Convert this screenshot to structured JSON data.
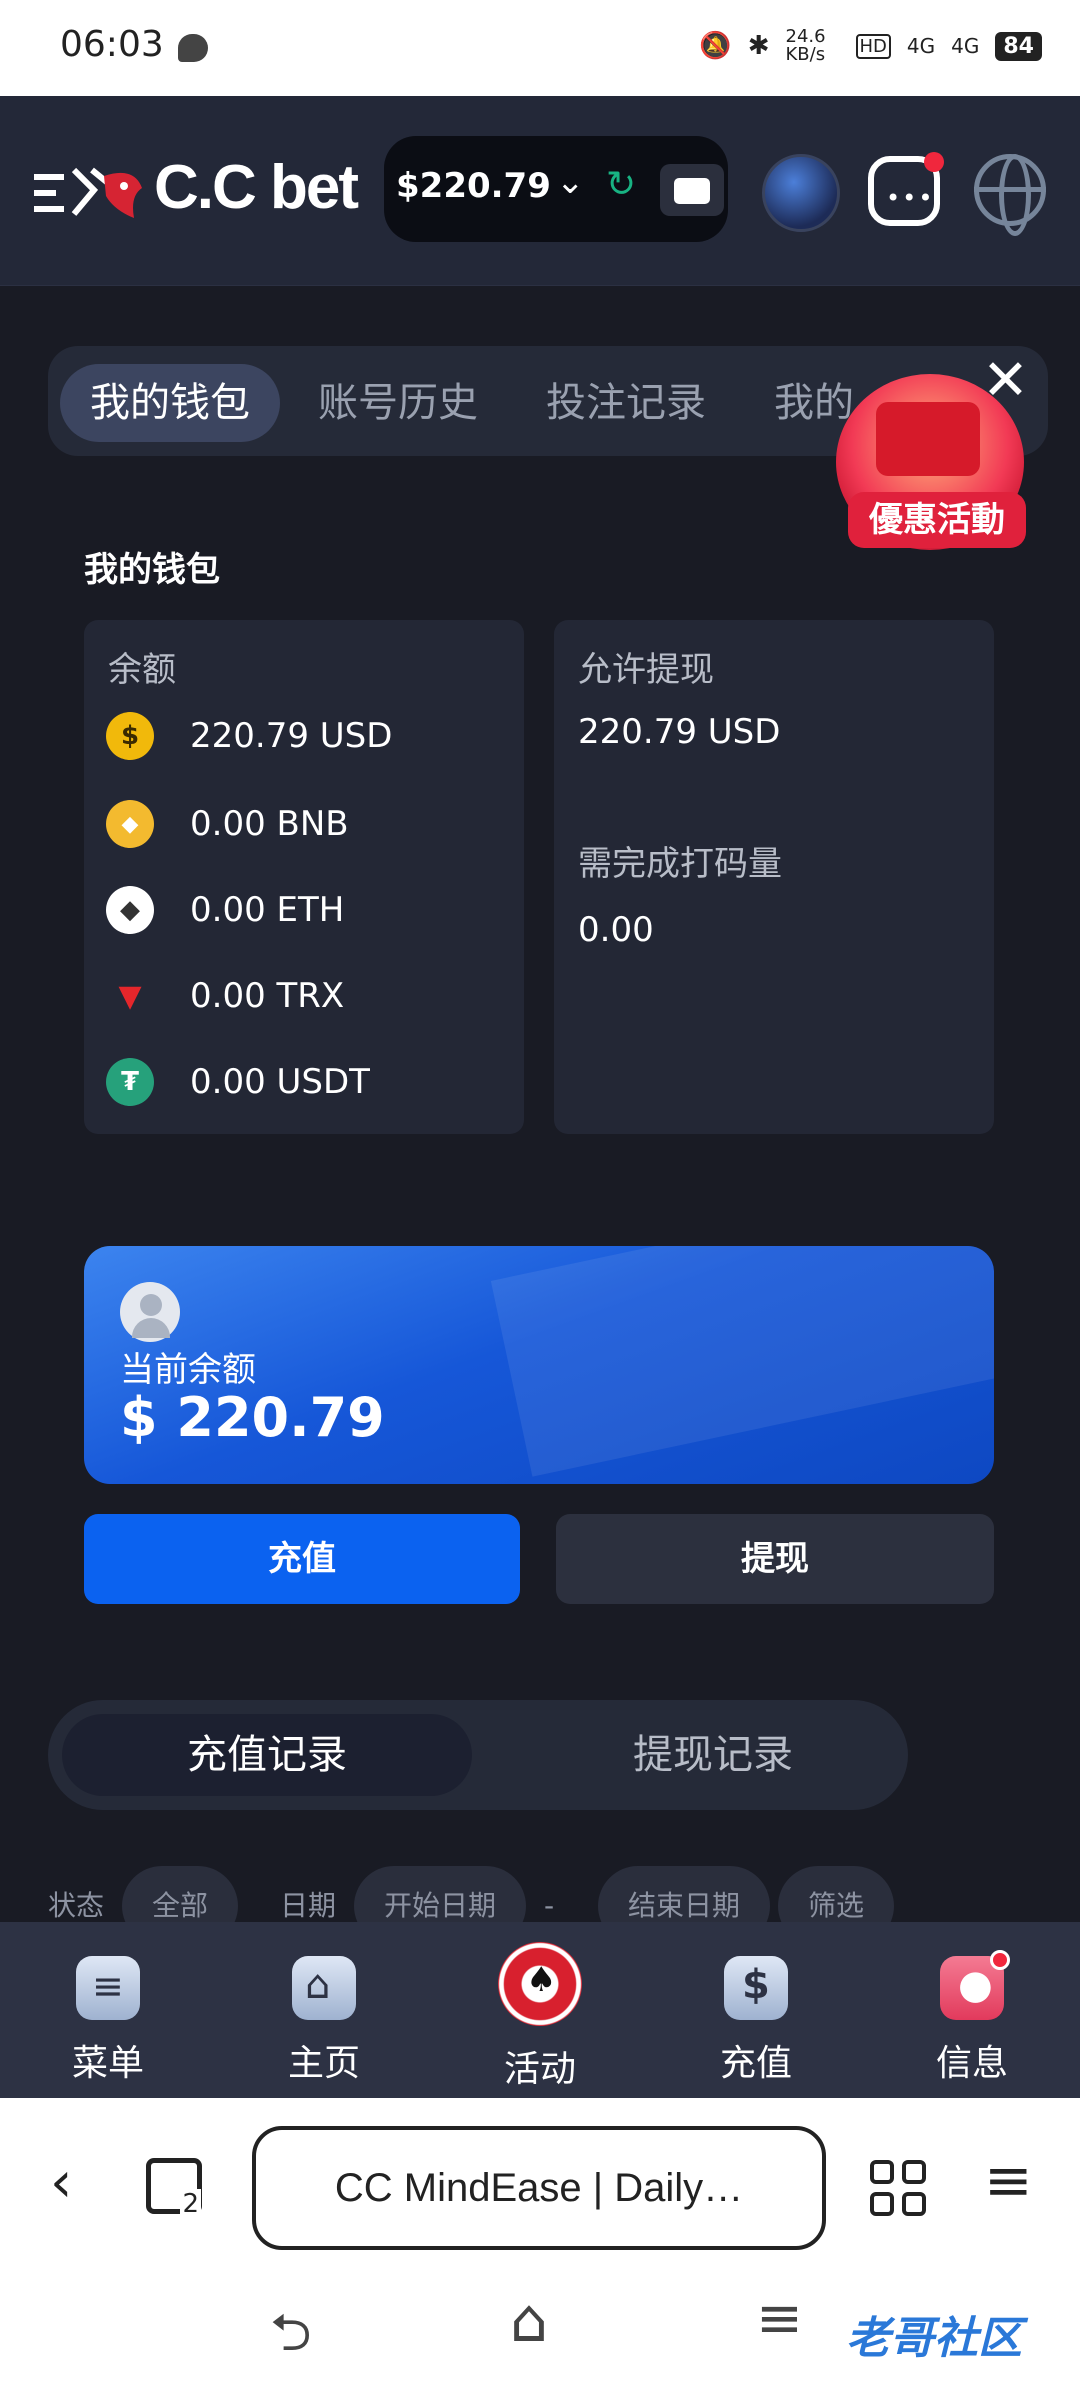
{
  "status": {
    "time": "06:03",
    "net_speed": "24.6 KB/s",
    "signal1": "4G",
    "signal2": "4G",
    "battery": "84",
    "hd": "HD"
  },
  "header": {
    "logo": "C.C bet",
    "balance": "$220.79"
  },
  "tabs": [
    "我的钱包",
    "账号历史",
    "投注记录",
    "我的"
  ],
  "promo": {
    "label": "優惠活動",
    "close": "✕"
  },
  "wallet": {
    "title": "我的钱包",
    "balance_label": "余额",
    "coins": [
      {
        "name": "USD",
        "text": "220.79 USD",
        "color": "#f1b90b",
        "symbol": "$"
      },
      {
        "name": "BNB",
        "text": "0.00 BNB",
        "color": "#f3ba2f",
        "symbol": "◆"
      },
      {
        "name": "ETH",
        "text": "0.00 ETH",
        "color": "#ffffff",
        "symbol": "◆"
      },
      {
        "name": "TRX",
        "text": "0.00 TRX",
        "color": "#e5262b",
        "symbol": "▼"
      },
      {
        "name": "USDT",
        "text": "0.00 USDT",
        "color": "#26a17b",
        "symbol": "₮"
      }
    ],
    "withdrawable_label": "允许提现",
    "withdrawable_value": "220.79 USD",
    "wager_label": "需完成打码量",
    "wager_value": "0.00"
  },
  "current": {
    "label": "当前余额",
    "amount": "$ 220.79"
  },
  "buttons": {
    "deposit": "充值",
    "withdraw": "提现"
  },
  "records": {
    "deposit": "充值记录",
    "withdraw": "提现记录"
  },
  "filter": {
    "status": "状态",
    "status_value": "全部",
    "date": "日期",
    "start": "开始日期",
    "dash": "-",
    "end": "结束日期",
    "filter": "筛选"
  },
  "nav": [
    "菜单",
    "主页",
    "活动",
    "充值",
    "信息"
  ],
  "browser": {
    "url": "CC MindEase | Daily…"
  },
  "watermark": "老哥社区"
}
